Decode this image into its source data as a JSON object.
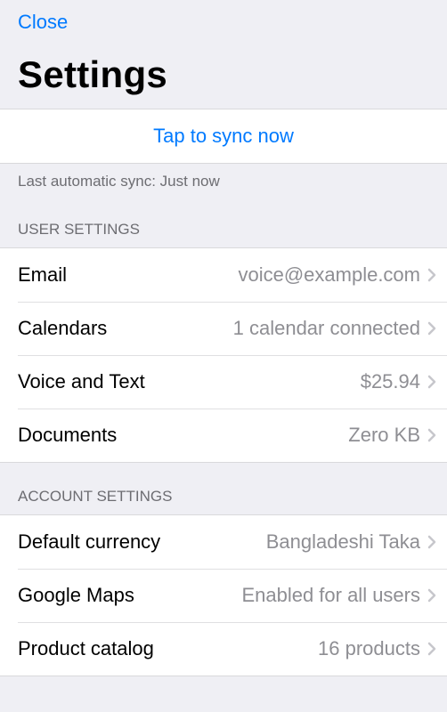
{
  "header": {
    "close_label": "Close",
    "title": "Settings"
  },
  "sync": {
    "button_label": "Tap to sync now",
    "status": "Last automatic sync: Just now"
  },
  "sections": {
    "user": {
      "header": "User Settings",
      "items": [
        {
          "label": "Email",
          "value": "voice@example.com"
        },
        {
          "label": "Calendars",
          "value": "1 calendar connected"
        },
        {
          "label": "Voice and Text",
          "value": "$25.94"
        },
        {
          "label": "Documents",
          "value": "Zero KB"
        }
      ]
    },
    "account": {
      "header": "Account Settings",
      "items": [
        {
          "label": "Default currency",
          "value": "Bangladeshi Taka"
        },
        {
          "label": "Google Maps",
          "value": "Enabled for all users"
        },
        {
          "label": "Product catalog",
          "value": "16 products"
        }
      ]
    }
  }
}
